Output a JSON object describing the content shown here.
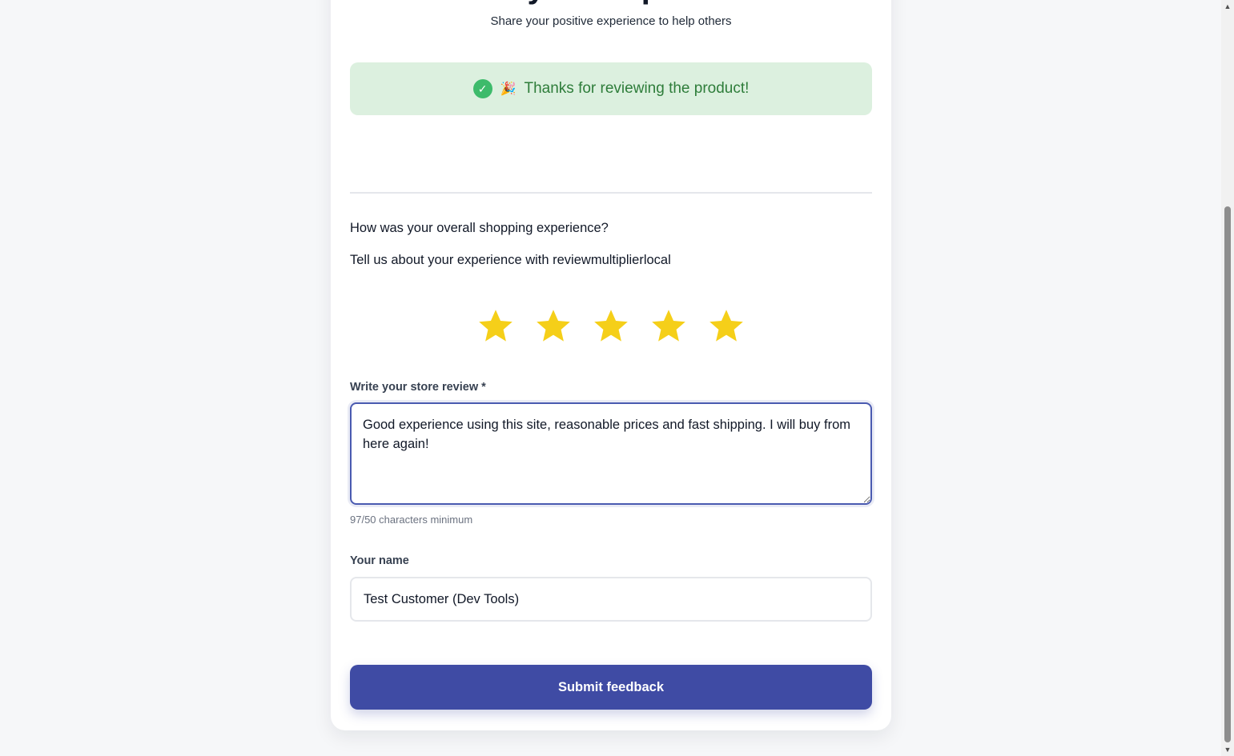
{
  "header": {
    "title": "Rate your experience",
    "subtitle": "Share your positive experience to help others"
  },
  "success": {
    "emoji": "🎉",
    "message": "Thanks for reviewing the product!"
  },
  "survey": {
    "question": "How was your overall shopping experience?",
    "prompt": "Tell us about your experience with reviewmultiplierlocal"
  },
  "rating": {
    "value": 5,
    "max": 5,
    "star_color": "#f5cf19"
  },
  "review": {
    "label": "Write your store review *",
    "value": "Good experience using this site, reasonable prices and fast shipping. I will buy from here again!",
    "char_count": "97/50 characters minimum"
  },
  "name": {
    "label": "Your name",
    "value": "Test Customer (Dev Tools)"
  },
  "submit": {
    "label": "Submit feedback",
    "color": "#3f4ba4"
  },
  "icons": {
    "success": "check-circle-icon",
    "celebration": "party-popper-icon",
    "rating": "star-icon"
  }
}
